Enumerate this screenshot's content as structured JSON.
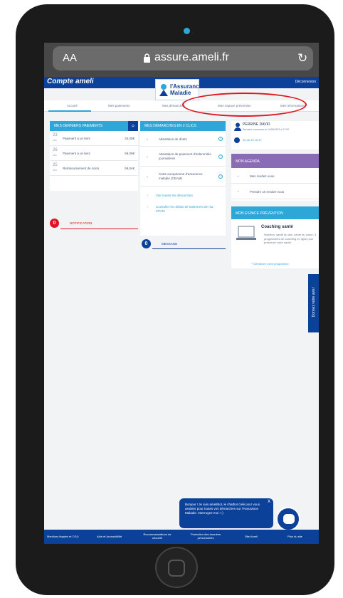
{
  "browser": {
    "text_size": "AA",
    "url": "assure.ameli.fr"
  },
  "header": {
    "brand": "Compte ameli",
    "logout": "Déconnexion",
    "logo_line1": "l'Assurance",
    "logo_line2": "Maladie"
  },
  "nav": [
    "Accueil",
    "Mes paiements",
    "Mes démarches",
    "Mon espace prévention",
    "Mes informations"
  ],
  "payments": {
    "title": "MES DERNIERS PAIEMENTS",
    "rows": [
      {
        "day": "23",
        "month": "JAN",
        "label": "Paiement à un tiers",
        "amount": "25,00€"
      },
      {
        "day": "26",
        "month": "JAN",
        "label": "Paiement à un tiers",
        "amount": "59,00€"
      },
      {
        "day": "25",
        "month": "JAN",
        "label": "Remboursement de soins",
        "amount": "59,04€"
      }
    ]
  },
  "notification": {
    "count": "0",
    "label": "NOTIFICATION"
  },
  "demarches": {
    "title": "MES DÉMARCHES EN 2 CLICS",
    "items": [
      "Attestation de droits",
      "Attestation de paiement d'indemnités journalières",
      "Carte européenne d'assurance maladie (CEAM)"
    ],
    "links": [
      "Voir toutes les démarches",
      "Consulter les délais de traitement de ma CPAM"
    ]
  },
  "message": {
    "count": "0",
    "label": "MESSAGE"
  },
  "user": {
    "name": "PERRINE DAVID",
    "last_login": "Dernière connexion le 14/06/2021 à 17:00",
    "phone": "36 46 25 16 47"
  },
  "agenda": {
    "title": "MON AGENDA",
    "items": [
      "Mes rendez-vous",
      "Prendre un rendez-vous"
    ]
  },
  "prevention": {
    "title": "MON ESPACE PRÉVENTION",
    "card_title": "Coaching santé",
    "card_text": "Nutrition, santé du dos, santé du coeur: 3 programmes de coaching en ligne pour préserver votre santé.",
    "link": "+ Démarrez votre programme"
  },
  "feedback": "Donnez votre avis !",
  "chatbot": {
    "text": "Bonjour ! Je suis ameliBot, le chatbot créé pour vous assister pour toutes vos démarches sur l'Assurance Maladie. Interrogez-moi ! :)",
    "close": "X"
  },
  "footer": [
    "Mentions légales et CGU",
    "Aide et Accessibilité",
    "Recommandations de sécurité",
    "Protection des données personnelles",
    "Site Ameli",
    "Plan du site"
  ]
}
